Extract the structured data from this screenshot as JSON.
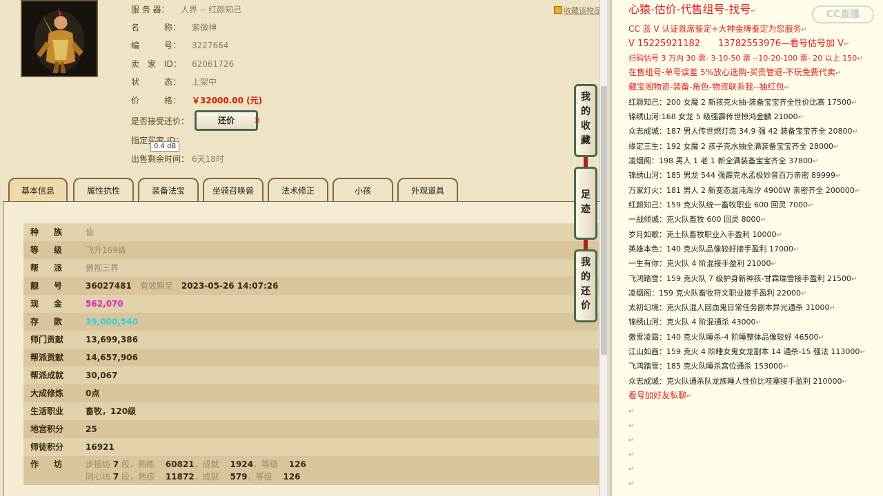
{
  "listing": {
    "server_label": "服 务 器：",
    "server": "人界 -- 红颜知己",
    "name_label": "名　　　称：",
    "name": "紫微神",
    "id_label": "编　　　号：",
    "id": "3227664",
    "seller_label": "卖　家　ID：",
    "seller_id": "62061726",
    "status_label": "状　　　态：",
    "status": "上架中",
    "price_label": "价　　　格：",
    "price": "￥32000.00 (元)",
    "accept_offer_label": "是否接受还价：",
    "offer_button": "还价",
    "designated_label": "指定买家 ID：",
    "remaining_label": "出售剩余时间：",
    "remaining": "6天18时",
    "favorite_link": "收藏该物品",
    "tooltip": "0.4 dB"
  },
  "tabs": [
    {
      "label": "基本信息",
      "active": true
    },
    {
      "label": "属性抗性",
      "active": false
    },
    {
      "label": "装备法宝",
      "active": false
    },
    {
      "label": "坐骑召唤兽",
      "active": false
    },
    {
      "label": "法术修正",
      "active": false
    },
    {
      "label": "小孩",
      "active": false
    },
    {
      "label": "外观道具",
      "active": false
    }
  ],
  "side_buttons": {
    "favorites": [
      "我",
      "的",
      "收",
      "藏"
    ],
    "footprints": [
      "足",
      "迹"
    ],
    "my_offers": [
      "我",
      "的",
      "还",
      "价"
    ]
  },
  "basic": {
    "race_label": "种族",
    "race": "仙",
    "level_label": "等级",
    "level": "飞升169级",
    "faction_label": "帮派",
    "faction": "傲视三界",
    "number_label": "靓号",
    "number": "36027481",
    "valid_label": "有效期至",
    "valid_until": "2023-05-26 14:07:26",
    "cash_label": "现金",
    "cash": "562,070",
    "deposit_label": "存款",
    "deposit": "39,000,540",
    "school_label": "师门贡献",
    "school": "13,699,386",
    "gang_contrib_label": "帮派贡献",
    "gang_contrib": "14,657,906",
    "gang_achieve_label": "帮派成就",
    "gang_achieve": "30,067",
    "dacheng_label": "大成修炼",
    "dacheng": "0点",
    "life_label": "生活职业",
    "life": "畜牧，120级",
    "palace_label": "地宫积分",
    "palace": "25",
    "mentor_label": "师徒积分",
    "mentor": "16921",
    "workshop_label": "作坊",
    "workshops": [
      {
        "name": "步摇坊",
        "grade": "7",
        "grade_unit": "段",
        "skill_label": "熟练",
        "skill": "60821",
        "achieve_label": "成就",
        "achieve": "1924",
        "level_label": "等级",
        "level": "126"
      },
      {
        "name": "同心坊",
        "grade": "7",
        "grade_unit": "段",
        "skill_label": "熟练",
        "skill": "11872",
        "achieve_label": "成就",
        "achieve": "579",
        "level_label": "等级",
        "level": "126"
      }
    ]
  },
  "notes": {
    "title": "心猿-估价-代售组号-找号",
    "watermark": "CC直播",
    "lines": [
      {
        "text": "CC 蓝 V 认证首席鉴定+大神金牌鉴定为您服务",
        "color": "red"
      },
      {
        "text": "V 15225921182　　13782553976—看号估号加 V",
        "color": "red"
      },
      {
        "text": "扫码估号 3 万内 30 票- 3-10-50 票  --10-20-100 票- 20 以上 150",
        "color": "red"
      },
      {
        "text": "在售组号-单号误差 5%放心选购-买贵管退-不玩免费代卖",
        "color": "red"
      },
      {
        "text": "藏宝阁物资-装备-角色-物资联系我--抽红包",
        "color": "red"
      },
      {
        "text": "红颜知己：200 女魔 2 新孩克火抽-装备宝宝齐全性价比高 17500",
        "color": "blk"
      },
      {
        "text": "锦绣山河:168 女龙 5 级强霹传世惊鸿金麟 21000",
        "color": "blk"
      },
      {
        "text": "众志成城：187 男人传世燃灯忽 34.9 强 42 装备宝宝齐全 20800",
        "color": "blk"
      },
      {
        "text": "缘定三生：192 女魔 2 孩子克水抽全满装备宝宝齐全 28000",
        "color": "blk"
      },
      {
        "text": "凌烟阁：198 男人 1 老 1 新全满装备宝宝齐全 37800",
        "color": "blk"
      },
      {
        "text": "锦绣山河：185 男龙 544 强霹克水孟极妙音百万亲密 89999",
        "color": "blk"
      },
      {
        "text": "万家灯火：181 男人 2 新变态混沌淘汐 4900W 亲密齐全 200000",
        "color": "blk"
      },
      {
        "text": "红颜知己：159 克火队统一畜牧职业 600 回灵 7000",
        "color": "blk"
      },
      {
        "text": "一战倾城：克火队畜牧 600 回灵 8000",
        "color": "blk"
      },
      {
        "text": "岁月如歌：克土队畜牧职业入手盈利 10000",
        "color": "blk"
      },
      {
        "text": "英雄本色：140 克火队品像较好接手盈利 17000",
        "color": "blk"
      },
      {
        "text": "一生有你：克火队 4 阶混接手盈利 21000",
        "color": "blk"
      },
      {
        "text": "飞鸿踏雪：159 克火队 7 级护身新神孩-甘霖瑞雪接手盈利 21500",
        "color": "blk"
      },
      {
        "text": "凌烟阁：159 克火队畜牧符文职业接手盈利 22000",
        "color": "blk"
      },
      {
        "text": "太初幻境：克火队混人回血鬼日常任务副本异光通杀 31000",
        "color": "blk"
      },
      {
        "text": "锦绣山河：克火队 4 阶混通杀 43000",
        "color": "blk"
      },
      {
        "text": "傲雪凌霜：140 克火队睡杀-4 阶睡整体品像较好 46500",
        "color": "blk"
      },
      {
        "text": "江山如画：159 克火 4 阶睡女鬼女龙副本 14 通杀-15 强法 113000",
        "color": "blk"
      },
      {
        "text": "飞鸿踏雪：185 克火队睡杀宫位通杀 153000",
        "color": "blk"
      },
      {
        "text": "众志成城：克火队通杀队龙族睡人性价比哇塞接手盈利 210000",
        "color": "blk"
      },
      {
        "text": "看号加好友私聊",
        "color": "red"
      }
    ]
  }
}
